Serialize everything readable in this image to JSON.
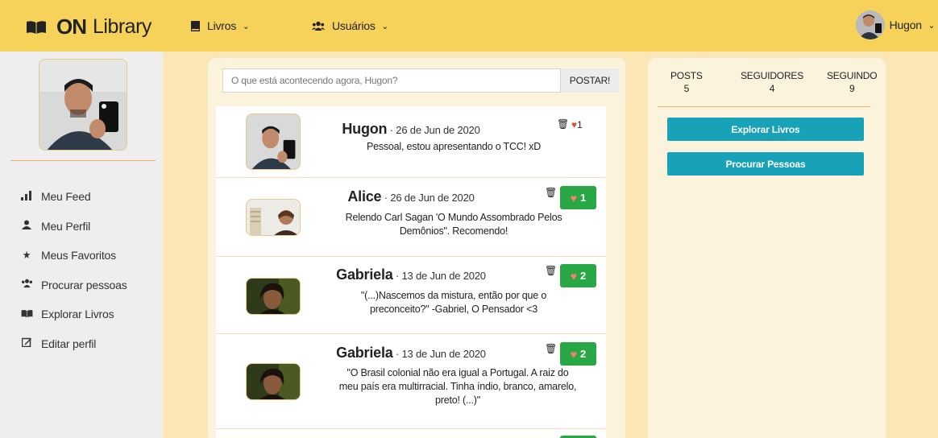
{
  "navbar": {
    "brand_on": "ON",
    "brand_library": "Library",
    "books_label": "Livros",
    "users_label": "Usuários",
    "username": "Hugon"
  },
  "sidebar": {
    "items": [
      {
        "icon": "feed-icon",
        "label": "Meu Feed"
      },
      {
        "icon": "user-icon",
        "label": "Meu Perfil"
      },
      {
        "icon": "star-icon",
        "label": "Meus Favoritos"
      },
      {
        "icon": "users-icon",
        "label": "Procurar pessoas"
      },
      {
        "icon": "book-icon",
        "label": "Explorar Livros"
      },
      {
        "icon": "edit-icon",
        "label": "Editar perfil"
      }
    ]
  },
  "composer": {
    "placeholder": "O que está acontecendo agora, Hugon?",
    "post_label": "POSTAR!"
  },
  "posts": [
    {
      "name": "Hugon",
      "date": " · 26 de Jun de 2020",
      "text": "Pessoal, estou apresentando o TCC! xD",
      "likes": "1"
    },
    {
      "name": "Alice",
      "date": " · 26 de Jun de 2020",
      "text": "Relendo Carl Sagan 'O Mundo Assombrado Pelos Demônios\". Recomendo!",
      "likes": "1"
    },
    {
      "name": "Gabriela",
      "date": " · 13 de Jun de 2020",
      "text": "\"(...)Nascemos da mistura, então por que o preconceito?\" -Gabriel, O Pensador <3",
      "likes": "2"
    },
    {
      "name": "Gabriela",
      "date": " · 13 de Jun de 2020",
      "text": "\"O Brasil colonial não era igual a Portugal. A raiz do meu país era multirracial. Tinha índio, branco, amarelo, preto! (...)\"",
      "likes": "2"
    }
  ],
  "stats": {
    "posts_label": "POSTS",
    "posts_value": "5",
    "followers_label": "SEGUIDORES",
    "followers_value": "4",
    "following_label": "SEGUINDO",
    "following_value": "9"
  },
  "actions": {
    "explore_books": "Explorar Livros",
    "find_people": "Procurar Pessoas"
  },
  "colors": {
    "navbar": "#f7d25a",
    "background": "#fbe6b8",
    "like_button": "#28a745",
    "action_button": "#17a2b8"
  }
}
